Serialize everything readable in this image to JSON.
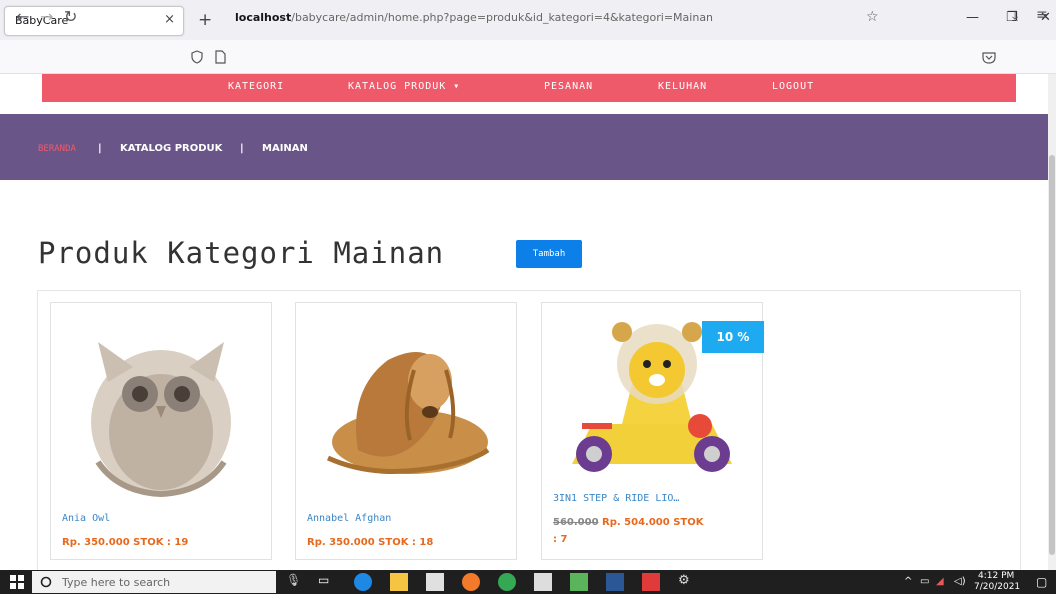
{
  "browser": {
    "tab_title": "BabyCare",
    "tab_close": "×",
    "new_tab": "+",
    "url_host": "localhost",
    "url_path": "/babycare/admin/home.php?page=produk&id_kategori=4&kategori=Mainan"
  },
  "topnav": {
    "items": [
      "KATEGORI",
      "KATALOG PRODUK ▾",
      "PESANAN",
      "KELUHAN",
      "LOGOUT"
    ]
  },
  "breadcrumb": {
    "home": "BERANDA",
    "sep": "|",
    "catalog": "KATALOG PRODUK",
    "category": "MAINAN"
  },
  "page": {
    "title": "Produk Kategori Mainan",
    "add_button": "Tambah"
  },
  "products": [
    {
      "name": "Ania Owl",
      "price": "Rp. 350.000 STOK : 19",
      "image": "owl-plush"
    },
    {
      "name": "Annabel Afghan",
      "price": "Rp. 350.000 STOK : 18",
      "image": "dog-plush"
    },
    {
      "name": "3IN1 STEP & RIDE LIO…",
      "old_price": "560.000",
      "price": "Rp. 504.000 STOK",
      "stock_line": ": 7",
      "badge": "10 %",
      "image": "lion-ride-on-toy"
    }
  ],
  "taskbar": {
    "search_placeholder": "Type here to search",
    "time": "4:12 PM",
    "date": "7/20/2021"
  },
  "colors": {
    "topnav": "#ef5a6a",
    "banner": "#6a5589",
    "accent_blue": "#0d7fe8",
    "price_orange": "#e8691c",
    "badge_blue": "#1eaaf1"
  }
}
